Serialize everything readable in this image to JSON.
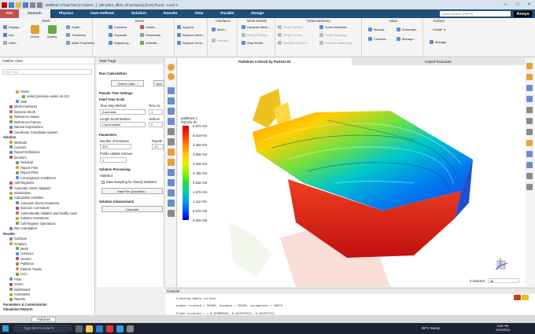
{
  "titlebar": {
    "title": "Wellbore 2 Fluid Flow [C:\\Users\\...] - [3D (pbns, dbns, 2D pressure)] [CSX] Fluent - Level 3"
  },
  "menu": {
    "file": "File",
    "items": [
      "Domain",
      "Physics",
      "User-Defined",
      "Solution",
      "Results",
      "View",
      "Parallel",
      "Design"
    ],
    "search_placeholder": "Quick Search (Ctrl+F)",
    "brand": "Ansys"
  },
  "ribbon": {
    "groups": [
      {
        "title": "Mesh",
        "buttons": [
          "Display...",
          "Info",
          "Units...",
          "Check",
          "Quality",
          "Scale...",
          "Transform",
          "Make Polyhedra"
        ]
      },
      {
        "title": "Zones",
        "buttons": [
          "Combine",
          "Separate",
          "Adjacency...",
          "Delete...",
          "Deactivate...",
          "Activate..."
        ]
      },
      {
        "title": "",
        "buttons": [
          "Append",
          "Replace Mesh...",
          "Replace Zone..."
        ]
      },
      {
        "title": "Interfaces",
        "buttons": [
          "Mesh...",
          "Overset..."
        ]
      },
      {
        "title": "Mesh Models",
        "buttons": [
          "Dynamic Mesh...",
          "Mixing Planes...",
          "Slap Model..."
        ]
      },
      {
        "title": "Turbomachinery",
        "buttons": [
          "Turbo Models",
          "Turbo Create...",
          "Spectral Content...",
          "Turbo Workflow",
          "Turbo Topology...",
          "Periodic Instancing..."
        ]
      },
      {
        "title": "Adapt",
        "buttons": [
          "Manual...",
          "Controls...",
          "Automatic...",
          "Manage..."
        ]
      },
      {
        "title": "Surface",
        "buttons": [
          "Create",
          "Manage..."
        ]
      }
    ]
  },
  "outline": {
    "header": "Outline View",
    "filter_placeholder": "Filter Text",
    "items": [
      "Outlet",
      "outlet (pressure-outlet, id=10)",
      "Wall",
      "Mesh Interfaces",
      "Dynamic Mesh",
      "Reference Values",
      "Reference Frames",
      "Named Expressions",
      "Curvilinear Coordinate System",
      "Solution",
      "Methods",
      "Controls",
      "Report Definitions",
      "Monitors",
      "Residual",
      "Report Files",
      "Report Plots",
      "Convergence Conditions",
      "Cell Registers",
      "Automatic Mesh Adaption",
      "Initialization",
      "Calculation Activities",
      "Autosave (Every Iterations)",
      "Execute Commands",
      "Automatically Initialize and Modify Case",
      "Solution Animations",
      "Cell Register Operations",
      "Run Calculation",
      "Results",
      "Surfaces",
      "Graphics",
      "Mesh",
      "Contours",
      "Vectors",
      "Pathlines",
      "Particle Tracks",
      "LICs",
      "Plots",
      "Scene",
      "Dashboard",
      "Animations",
      "Reports",
      "Parameters & Customization",
      "Simulation Reports"
    ]
  },
  "taskpage": {
    "header": "Task Page",
    "title": "Run Calculation",
    "check_case": "Check Case...",
    "update": "Upd",
    "pseudo_settings": "Pseudo Time Settings",
    "fluid_time_scale": "Fluid Time Scale",
    "time_step_method": "Time Step Method",
    "time_step_method_value": "Automatic",
    "time_scale": "Time Sc",
    "time_scale_value": "1",
    "length_scale_method": "Length Scale Method",
    "length_scale_value": "Conservative",
    "verbosity": "Verbosi",
    "verbosity_value": "0",
    "parameters": "Parameters",
    "num_iterations": "Number of Iterations",
    "num_iterations_value": "300",
    "reporting": "Reporti",
    "reporting_value": "10",
    "profile_update": "Profile Update Interval",
    "profile_update_value": "1",
    "solution_processing": "Solution Processing",
    "statistics": "Statistics",
    "data_sampling": "Data Sampling for Steady Statistics",
    "data_file_quantities": "Data File Quantities...",
    "solution_advancement": "Solution Advancement",
    "calculate": "Calculate"
  },
  "graphics": {
    "tab1": "Pathlines Colored by Particle ID",
    "tab2": "Scaled Residuals",
    "legend_title": "pathlines-1",
    "legend_subtitle": "Particle ID",
    "legend_values": [
      "5.57e+04",
      "5.01e+04",
      "4.45e+04",
      "3.90e+04",
      "3.34e+04",
      "2.78e+04",
      "2.23e+04",
      "1.67e+04",
      "1.11e+04",
      "5.57e+03",
      "0.00e+00"
    ],
    "legend_colors": [
      "#d10000",
      "#ff3000",
      "#ff8000",
      "#ffc800",
      "#e8f000",
      "#90f000",
      "#20e040",
      "#00d0a0",
      "#00a0e8",
      "#0050ff",
      "#0000c8"
    ],
    "selected_label": "0 selected",
    "selected_value": "all"
  },
  "console": {
    "header": "Console",
    "lines": [
      "Creating empty surface.",
      "number tracked = 55684, escaped = 29585, incomplete = 26079",
      "Probe location = (-0.07889660,-0.022597922,-0.06795741)"
    ]
  },
  "statusbar": {
    "tab_label": "Pathlines"
  },
  "taskbar": {
    "search_placeholder": "Type here to search",
    "weather": "28°C Sunny",
    "time": "3:28 PM",
    "date": "2/24/2024"
  }
}
